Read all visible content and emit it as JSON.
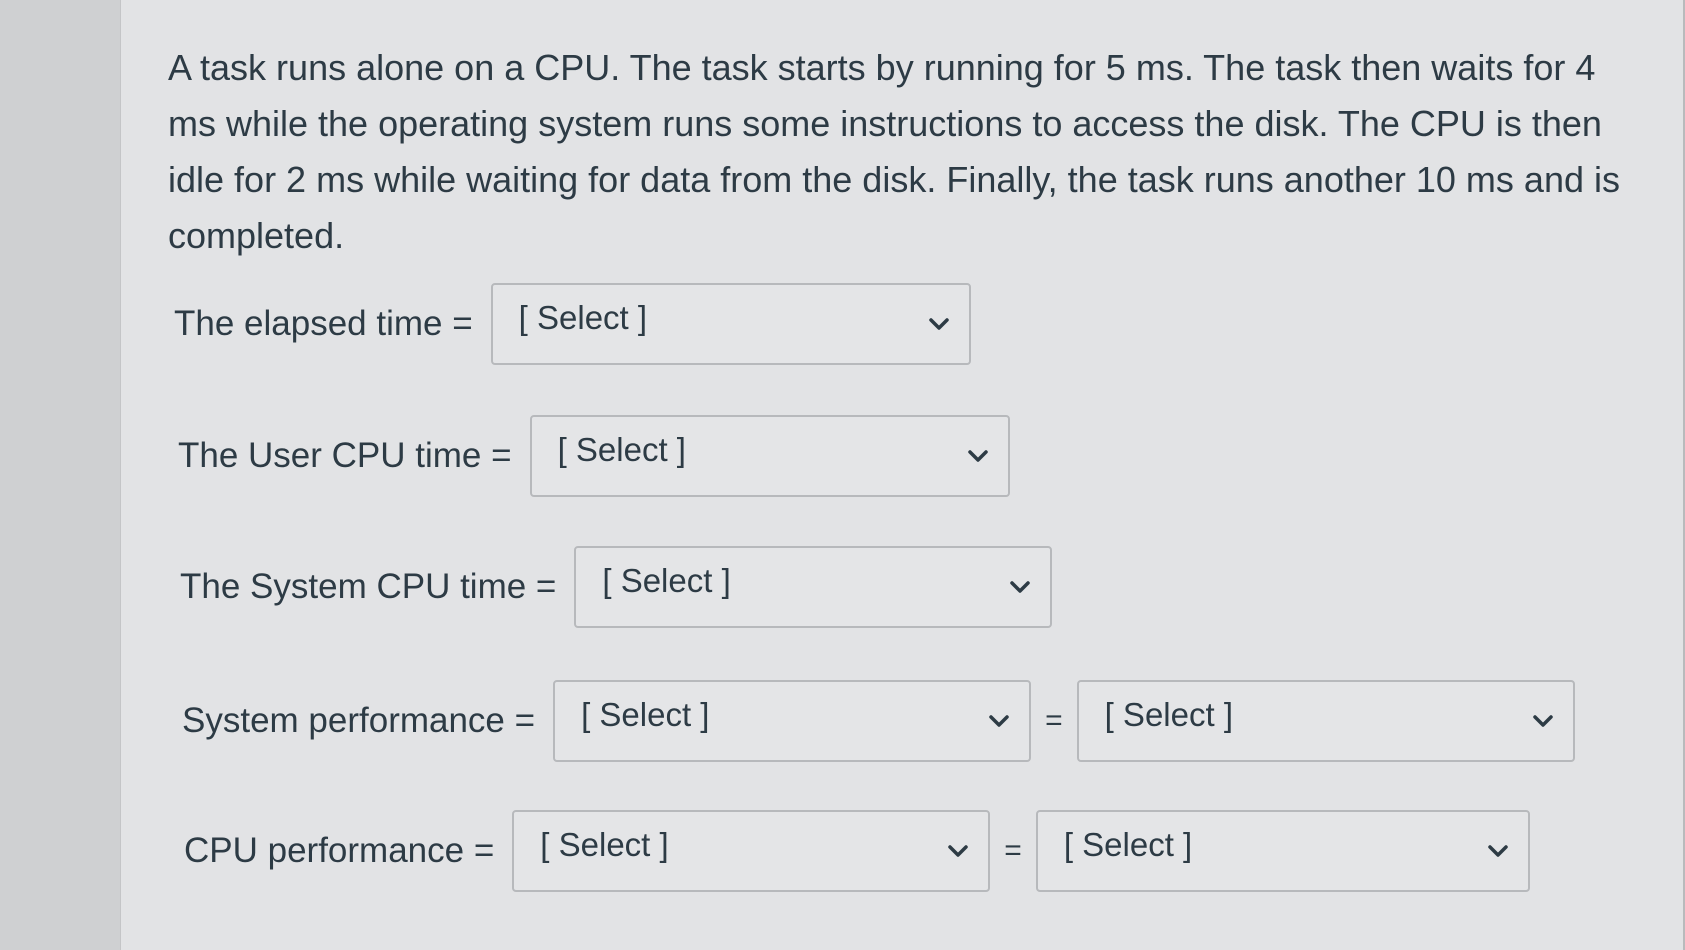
{
  "question": {
    "text": "A task runs alone on a CPU. The task starts by running for 5 ms. The task then waits for 4 ms while the operating system runs some instructions to access the disk. The CPU is then idle for 2 ms while waiting for data from the disk. Finally, the task runs another 10 ms and is completed."
  },
  "rows": {
    "elapsed": {
      "label": "The elapsed time =",
      "select": "[ Select ]"
    },
    "user_cpu": {
      "label": "The User CPU time =",
      "select": "[ Select ]"
    },
    "system_cpu": {
      "label": "The System CPU time =",
      "select": "[ Select ]"
    },
    "system_perf": {
      "label": "System performance =",
      "select1": "[ Select ]",
      "equals": "=",
      "select2": "[ Select ]"
    },
    "cpu_perf": {
      "label": "CPU performance =",
      "select1": "[ Select ]",
      "equals": "=",
      "select2": "[ Select ]"
    }
  },
  "icons": {
    "dropdown": "chevron-down-icon"
  }
}
